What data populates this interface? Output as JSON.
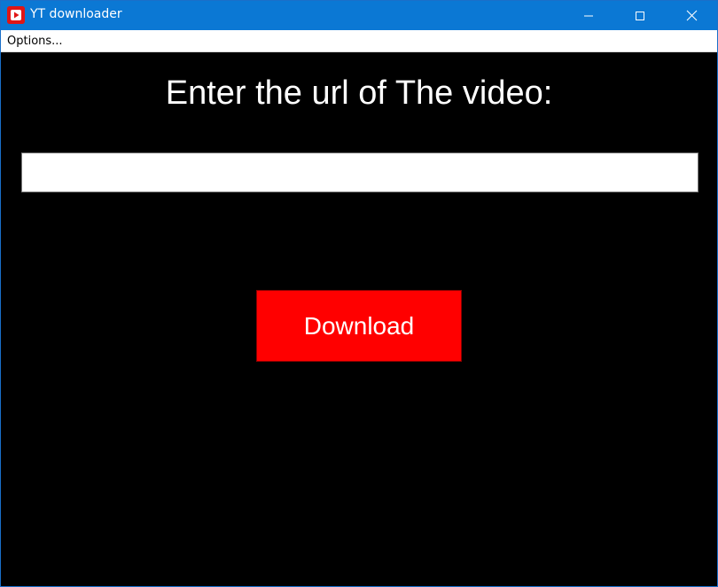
{
  "window": {
    "title": "YT downloader",
    "icon": "youtube-play-icon",
    "controls": {
      "minimize": "minimize-icon",
      "maximize": "maximize-icon",
      "close": "close-icon"
    }
  },
  "menubar": {
    "items": [
      {
        "label": "Options..."
      }
    ]
  },
  "main": {
    "heading": "Enter the url of The video:",
    "url_input": {
      "value": "",
      "placeholder": ""
    },
    "download_button": {
      "label": "Download"
    }
  },
  "colors": {
    "titlebar": "#0b78d4",
    "background": "#000000",
    "button": "#ff0000",
    "icon_red": "#e01616"
  }
}
